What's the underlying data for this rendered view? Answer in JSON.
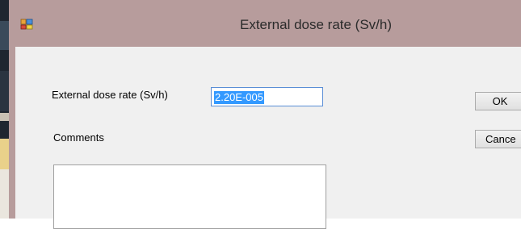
{
  "window": {
    "title": "External dose rate (Sv/h)",
    "titlebar_color": "#b79c9c",
    "icon": "application-icon"
  },
  "form": {
    "dose_label": "External dose rate (Sv/h)",
    "dose_value": "2.20E-005",
    "comments_label": "Comments",
    "comments_value": ""
  },
  "buttons": {
    "ok_label": "OK",
    "cancel_label": "Cance"
  },
  "colors": {
    "selection": "#3399ff",
    "input_focus_border": "#5a8ed6",
    "client_background": "#f0f0f0"
  }
}
